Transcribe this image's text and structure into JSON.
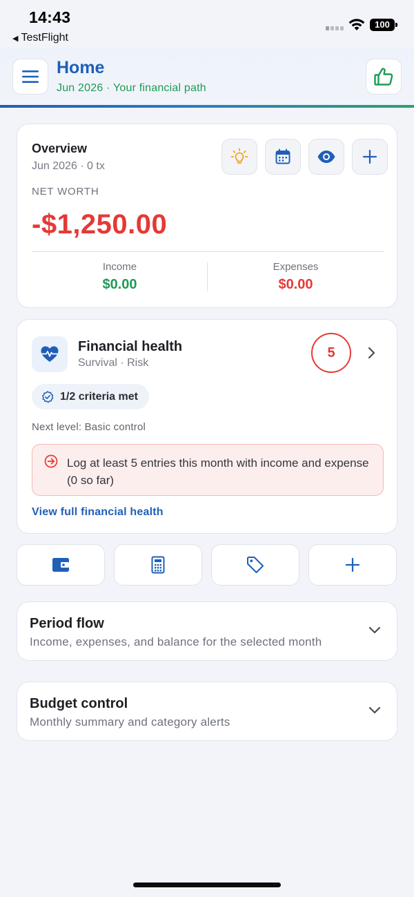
{
  "status_bar": {
    "time": "14:43",
    "back_app": "TestFlight",
    "battery": "100"
  },
  "header": {
    "title": "Home",
    "subtitle": "Jun 2026 · Your financial path"
  },
  "overview": {
    "title": "Overview",
    "subtitle": "Jun 2026 · 0 tx",
    "net_worth_label": "NET WORTH",
    "net_worth_value": "-$1,250.00",
    "income_label": "Income",
    "income_value": "$0.00",
    "expenses_label": "Expenses",
    "expenses_value": "$0.00",
    "actions": [
      "lightbulb-icon",
      "calendar-icon",
      "eye-icon",
      "plus-icon"
    ]
  },
  "financial_health": {
    "title": "Financial health",
    "subtitle": "Survival · Risk",
    "score": "5",
    "criteria": "1/2 criteria met",
    "next_level": "Next level: Basic control",
    "alert": "Log at least 5 entries this month with income and expense (0 so far)",
    "link": "View full financial health"
  },
  "quick_actions": [
    "wallet-icon",
    "calculator-icon",
    "tag-icon",
    "plus-icon"
  ],
  "period_flow": {
    "title": "Period flow",
    "subtitle": "Income, expenses, and balance for the selected month"
  },
  "budget_control": {
    "title": "Budget control",
    "subtitle": "Monthly summary and category alerts"
  },
  "colors": {
    "primary": "#1f5fb8",
    "positive": "#1e9a55",
    "negative": "#e53935",
    "warning": "#f4a11b"
  }
}
